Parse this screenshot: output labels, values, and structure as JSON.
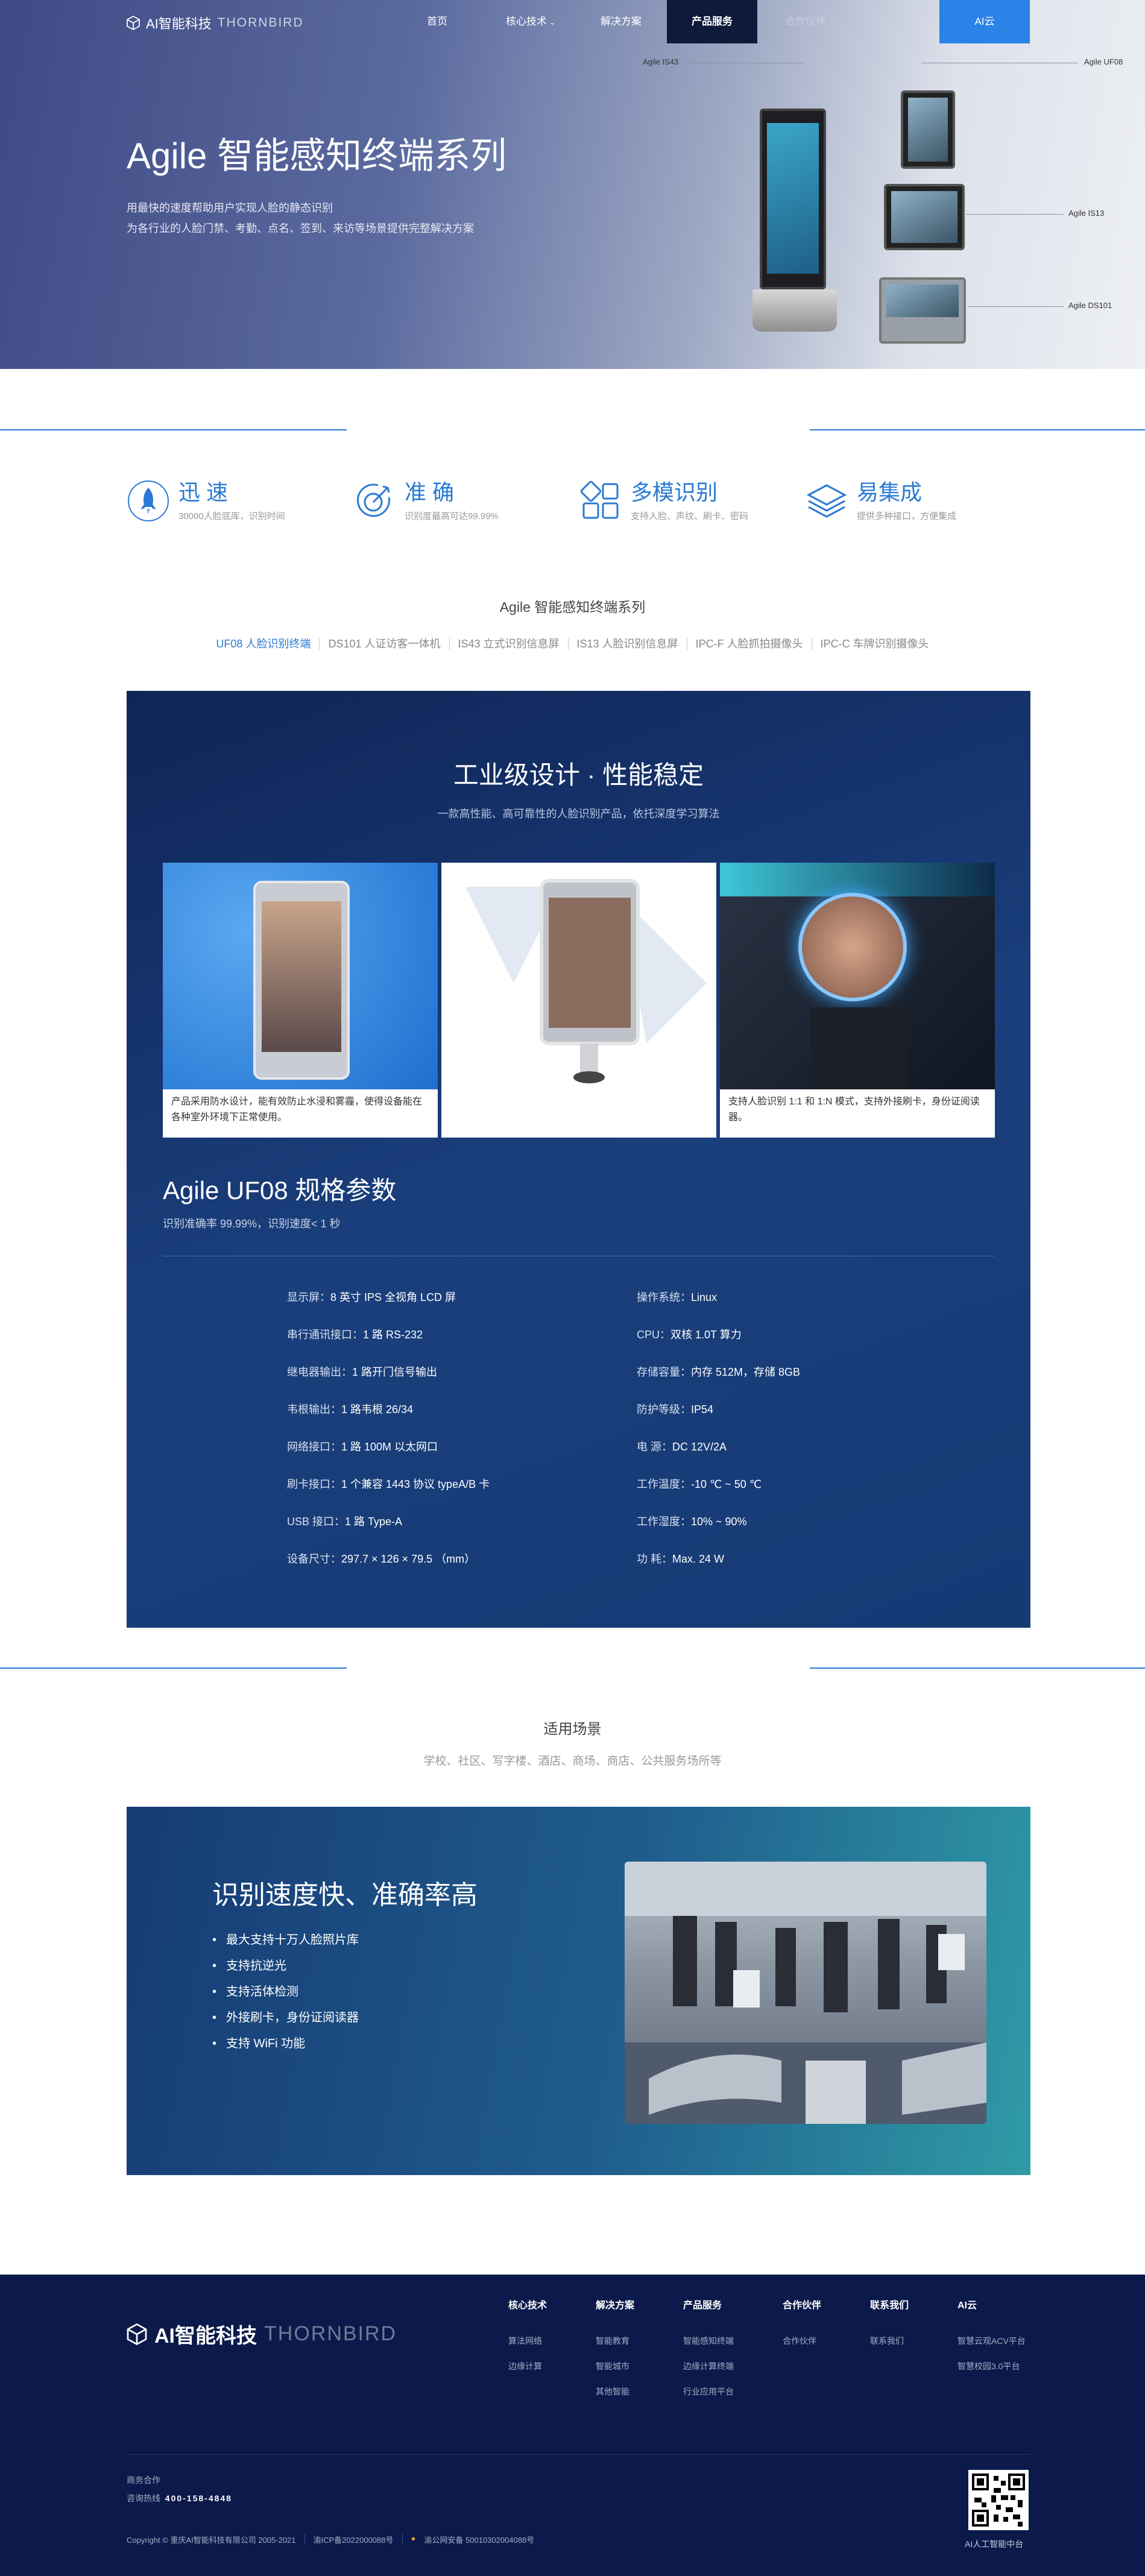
{
  "header": {
    "logo_cn": "AI智能科技",
    "logo_en": "THORNBIRD",
    "nav": [
      {
        "label": "首页"
      },
      {
        "label": "核心技术"
      },
      {
        "label": "解决方案"
      },
      {
        "label": "产品服务"
      },
      {
        "label": "合作伙伴"
      },
      {
        "label": "AI云"
      }
    ]
  },
  "hero": {
    "title": "Agile 智能感知终端系列",
    "line1": "用最快的速度帮助用户实现人脸的静态识别",
    "line2": "为各行业的人脸门禁、考勤、点名、签到、来访等场景提供完整解决方案",
    "labels": [
      "Agile IS43",
      "Agile UF08",
      "Agile IS13",
      "Agile DS101"
    ]
  },
  "features": [
    {
      "title": "迅 速",
      "desc": "30000人脸底库，识别时间",
      "icon": "rocket-icon"
    },
    {
      "title": "准 确",
      "desc": "识别度最高可达99.99%",
      "icon": "target-icon"
    },
    {
      "title": "多模识别",
      "desc": "支持人脸、声纹、刷卡、密码",
      "icon": "grid-icon"
    },
    {
      "title": "易集成",
      "desc": "提供多种接口，方便集成",
      "icon": "layers-icon"
    }
  ],
  "series": {
    "title": "Agile 智能感知终端系列",
    "tabs": [
      "UF08 人脸识别终端",
      "DS101 人证访客一体机",
      "IS43 立式识别信息屏",
      "IS13 人脸识别信息屏",
      "IPC-F 人脸抓拍摄像头",
      "IPC-C 车牌识别摄像头"
    ]
  },
  "panel": {
    "title": "工业级设计 · 性能稳定",
    "subtitle": "一款高性能、高可靠性的人脸识别产品，依托深度学习算法",
    "cards": [
      {
        "caption": "产品采用防水设计，能有效防止水浸和雾霾，使得设备能在各种室外环境下正常使用。"
      },
      {
        "caption": ""
      },
      {
        "caption": "支持人脸识别 1:1 和 1:N 模式，支持外接刷卡，身份证阅读器。"
      }
    ],
    "spec_title": "Agile UF08 规格参数",
    "spec_sub": "识别准确率 99.99%，识别速度< 1 秒",
    "specs_left": [
      {
        "k": "显示屏：",
        "v": "8 英寸 IPS 全视角 LCD 屏"
      },
      {
        "k": "串行通讯接口：",
        "v": "1 路 RS-232"
      },
      {
        "k": "继电器输出：",
        "v": "1 路开门信号输出"
      },
      {
        "k": "韦根输出：",
        "v": "1 路韦根 26/34"
      },
      {
        "k": "网络接口：",
        "v": "1 路 100M 以太网口"
      },
      {
        "k": "刷卡接口：",
        "v": "1 个兼容 1443 协议 typeA/B 卡"
      },
      {
        "k": "USB 接口：",
        "v": "1 路 Type-A"
      },
      {
        "k": "设备尺寸：",
        "v": "297.7 × 126 × 79.5 （mm）"
      }
    ],
    "specs_right": [
      {
        "k": "操作系统：",
        "v": "Linux"
      },
      {
        "k": "CPU：",
        "v": "双核 1.0T 算力"
      },
      {
        "k": "存储容量：",
        "v": "内存 512M，存储 8GB"
      },
      {
        "k": "防护等级：",
        "v": "IP54"
      },
      {
        "k": "电 源：",
        "v": "DC 12V/2A"
      },
      {
        "k": "工作温度：",
        "v": "-10 ℃ ~ 50 ℃"
      },
      {
        "k": "工作湿度：",
        "v": "10% ~ 90%"
      },
      {
        "k": "功 耗：",
        "v": "Max. 24 W"
      }
    ]
  },
  "scenario": {
    "title": "适用场景",
    "subtitle": "学校、社区、写字楼、酒店、商场、商店、公共服务场所等",
    "heading": "识别速度快、准确率高",
    "bullets": [
      "最大支持十万人脸照片库",
      "支持抗逆光",
      "支持活体检测",
      "外接刷卡，身份证阅读器",
      "支持 WiFi 功能"
    ]
  },
  "footer": {
    "logo_cn": "AI智能科技",
    "logo_en": "THORNBIRD",
    "columns": [
      {
        "head": "核心技术",
        "links": [
          "算法网络",
          "边缘计算"
        ]
      },
      {
        "head": "解决方案",
        "links": [
          "智能教育",
          "智能城市",
          "其他智能"
        ]
      },
      {
        "head": "产品服务",
        "links": [
          "智能感知终端",
          "边缘计算终端",
          "行业应用平台"
        ]
      },
      {
        "head": "合作伙伴",
        "links": [
          "合作伙伴"
        ]
      },
      {
        "head": "联系我们",
        "links": [
          "联系我们"
        ]
      },
      {
        "head": "AI云",
        "links": [
          "智慧云观ACV平台",
          "智慧校园3.0平台"
        ]
      }
    ],
    "biz_label": "商务合作",
    "hotline_label": "咨询热线",
    "hotline": "400-158-4848",
    "copyright": "Copyright © 重庆AI智能科技有限公司 2005-2021",
    "icp": "渝ICP备2022000088号",
    "police": "渝公网安备 50010302004088号",
    "qr_caption": "AI人工智能中台"
  }
}
